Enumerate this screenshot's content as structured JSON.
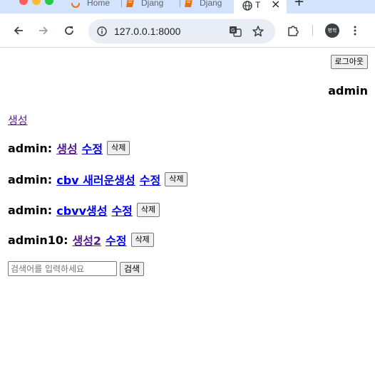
{
  "browser": {
    "tabs": [
      {
        "title": "Home"
      },
      {
        "title": "Djang"
      },
      {
        "title": "Djang"
      },
      {
        "title": "T"
      }
    ],
    "new_tab": "+",
    "close_glyph": "×",
    "url": "127.0.0.1:8000",
    "profile_initials": "병학",
    "icons": [
      "back-icon",
      "forward-icon",
      "reload-icon",
      "site-info-icon",
      "translate-icon",
      "bookmark-star-icon",
      "extensions-icon"
    ]
  },
  "header": {
    "logout_label": "로그아웃",
    "username": "admin"
  },
  "create_link": "생성",
  "posts": [
    {
      "author": "admin:",
      "title": "생성",
      "edit": "수정",
      "delete": "삭제"
    },
    {
      "author": "admin:",
      "title": "cbv 새러운생성",
      "edit": "수정",
      "delete": "삭제"
    },
    {
      "author": "admin:",
      "title": "cbvv생성",
      "edit": "수정",
      "delete": "삭제"
    },
    {
      "author": "admin10:",
      "title": "생성2",
      "edit": "수정",
      "delete": "삭제"
    }
  ],
  "search": {
    "placeholder": "검색어를 입력하세요",
    "value": "",
    "button_label": "검색"
  },
  "colors": {
    "tabstrip": "#d3e3fd",
    "link": "#0000ee",
    "visited_link": "#551a8b"
  }
}
